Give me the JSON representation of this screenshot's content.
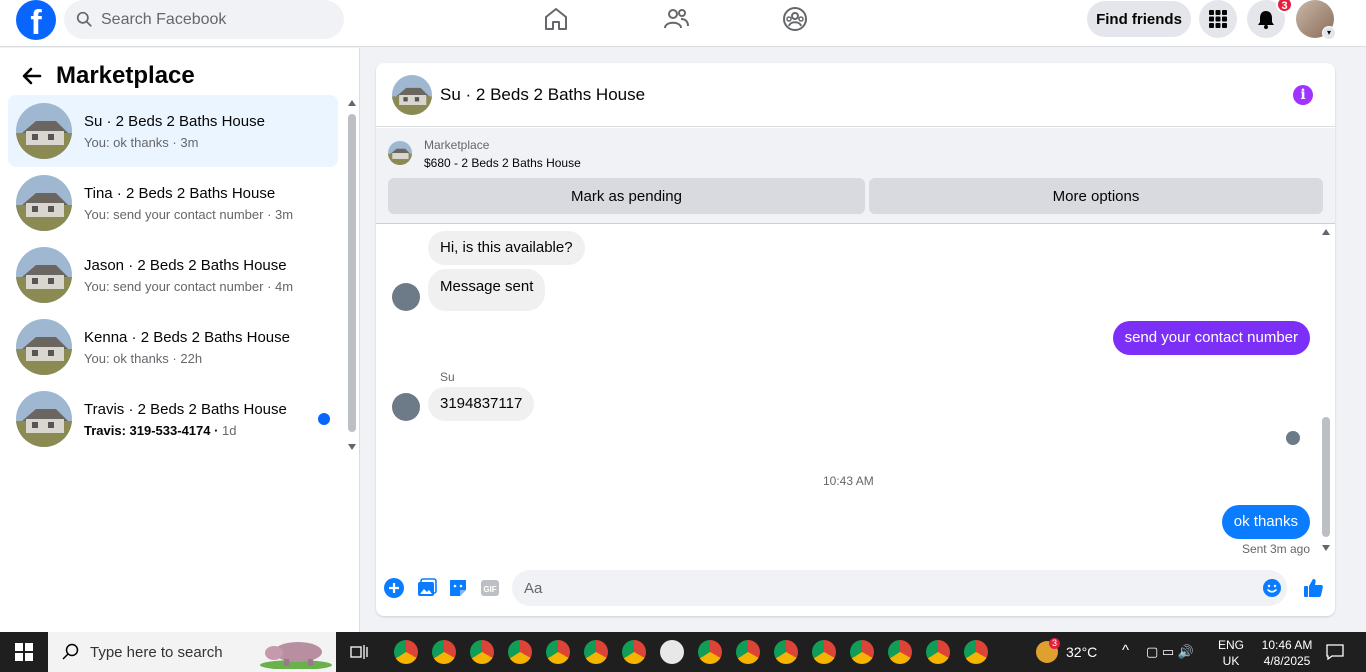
{
  "topbar": {
    "logo_letter": "f",
    "search_placeholder": "Search Facebook",
    "find_friends_label": "Find friends",
    "notification_count": "3"
  },
  "left": {
    "title": "Marketplace",
    "conversations": [
      {
        "title": "Su · 2 Beds 2 Baths House",
        "preview": "You: ok thanks",
        "time": "3m",
        "active": true,
        "unread": false
      },
      {
        "title": "Tina · 2 Beds 2 Baths House",
        "preview": "You: send your contact number",
        "time": "3m",
        "active": false,
        "unread": false
      },
      {
        "title": "Jason · 2 Beds 2 Baths House",
        "preview": "You: send your contact number",
        "time": "4m",
        "active": false,
        "unread": false
      },
      {
        "title": "Kenna · 2 Beds 2 Baths House",
        "preview": "You: ok thanks",
        "time": "22h",
        "active": false,
        "unread": false
      },
      {
        "title": "Travis · 2 Beds 2 Baths House",
        "preview": "Travis: 319-533-4174",
        "time": "1d",
        "active": false,
        "unread": true
      }
    ]
  },
  "chat": {
    "title": "Su · 2 Beds 2 Baths House",
    "listing_label": "Marketplace",
    "listing_price": "$680 - 2 Beds 2 Baths House",
    "mark_pending_label": "Mark as pending",
    "more_options_label": "More options",
    "messages": {
      "m1": "Hi, is this available?",
      "m2": "Message sent",
      "m3": "send your contact number",
      "sender": "Su",
      "m4": "3194837117",
      "timestamp": "10:43 AM",
      "m5": "ok thanks",
      "status": "Sent 3m ago"
    },
    "composer_placeholder": "Aa"
  },
  "taskbar": {
    "search_placeholder": "Type here to search",
    "weather_temp": "32°C",
    "weather_badge": "3",
    "lang_line1": "ENG",
    "lang_line2": "UK",
    "time": "10:46 AM",
    "date": "4/8/2025"
  },
  "colors": {
    "brand": "#0866ff",
    "purple_bubble": "#7b2ff7",
    "blue_bubble": "#0a7cff",
    "info": "#a033ff"
  }
}
